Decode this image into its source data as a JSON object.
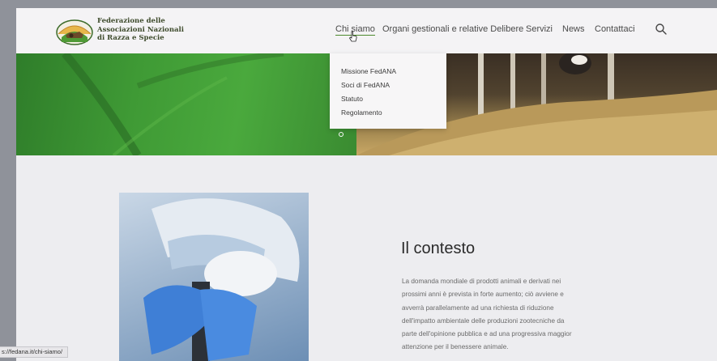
{
  "brand": {
    "lines": [
      "Federazione delle",
      "Associazioni Nazionali",
      "di Razza e Specie"
    ]
  },
  "nav": {
    "items": [
      "Chi siamo",
      "Organi gestionali e relative Delibere",
      "Servizi",
      "News",
      "Contattaci"
    ],
    "active": "Chi siamo"
  },
  "dropdown": {
    "items": [
      "Missione FedANA",
      "Soci di FedANA",
      "Statuto",
      "Regolamento"
    ]
  },
  "main": {
    "title": "Il contesto",
    "paragraph_lines": [
      "La domanda mondiale di prodotti animali e derivati nei",
      "prossimi anni è prevista in forte aumento; ciò avviene e",
      "avverrà parallelamente ad una richiesta di riduzione",
      "dell'impatto ambientale delle produzioni zootecniche da",
      "parte dell'opinione pubblica e ad una progressiva maggior",
      "attenzione per il benessere animale."
    ]
  },
  "status_bar": {
    "url": "s://fedana.it/chi-siamo/"
  },
  "colors": {
    "brand_green": "#4c8a2c",
    "banner_green": "#3f9a35"
  },
  "icons": [
    "logo-emblem-icon",
    "search-icon",
    "cursor-hand-icon"
  ]
}
